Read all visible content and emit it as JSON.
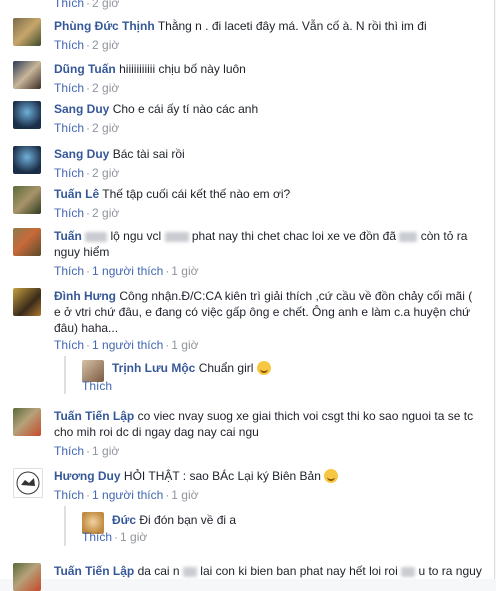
{
  "comments": [
    {
      "name": "Phùng Đức Thịnh",
      "text": "Thằng n . đi laceti đây má. Vẫn cố à. N rồi thì im đi",
      "actions": [
        "Thích",
        "2 giờ"
      ]
    },
    {
      "name": "Dũng Tuấn",
      "text": "hiiiiiiiiiii chịu bố này luôn",
      "actions": [
        "Thích",
        "2 giờ"
      ]
    },
    {
      "name": "Sang Duy",
      "text": "Cho e cái ấy tí nào các anh",
      "actions": [
        "Thích",
        "2 giờ"
      ]
    },
    {
      "name": "Sang Duy",
      "text": "Bác tài sai rồi",
      "actions": [
        "Thích",
        "2 giờ"
      ]
    },
    {
      "name": "Tuấn Lê",
      "text": "Thế tập cuối cái kết thế nào em ơi?",
      "actions": [
        "Thích",
        "2 giờ"
      ]
    },
    {
      "name": "Tuấn",
      "text_a": "lộ ngu vcl",
      "text_b": "phat nay thi chet chac loi xe ve đồn đã",
      "text_c": "còn tỏ ra nguy hiểm",
      "actions": [
        "Thích",
        "1 người thích",
        "1 giờ"
      ]
    },
    {
      "name": "Đình Hưng",
      "text": "Công nhận.Đ/C:CA kiên trì giải thích ,cứ cầu về đồn chảy cối mãi ( e ở vtri chứ đâu, e đang có việc gấp ông e chết. Ông anh e làm c.a huyện chứ đâu) haha...",
      "actions": [
        "Thích",
        "1 người thích",
        "1 giờ"
      ]
    },
    {
      "name": "Trịnh Lưu Mộc",
      "text": "Chuẩn girl",
      "actions": [
        "Thích"
      ]
    },
    {
      "name": "Tuấn Tiến Lập",
      "text": "co viec nvay suog xe giai thich voi csgt thi ko sao nguoi ta se tc cho mih roi dc di ngay dag nay cai ngu",
      "actions": [
        "Thích",
        "1 giờ"
      ]
    },
    {
      "name": "Hương Duy",
      "text": "HỎI THẬT : sao BÁc Lại ký Biên Bản",
      "actions": [
        "Thích",
        "1 người thích",
        "1 giờ"
      ]
    },
    {
      "name": "Đức",
      "text": "Đi đón bạn về đi a",
      "actions": [
        "Thích",
        "1 giờ"
      ]
    },
    {
      "name": "Tuấn Tiến Lập",
      "text_a": "da cai n",
      "text_b": "lai con ki bien ban phat nay hết loi roi",
      "text_c": "u to ra nguy"
    }
  ],
  "colors": {
    "link": "#365899",
    "action": "#4267b2",
    "meta": "#90949c",
    "emoji": "#f7c744"
  },
  "icons": {
    "laugh": "laughing-emoji-icon",
    "smile": "smiling-emoji-icon"
  }
}
